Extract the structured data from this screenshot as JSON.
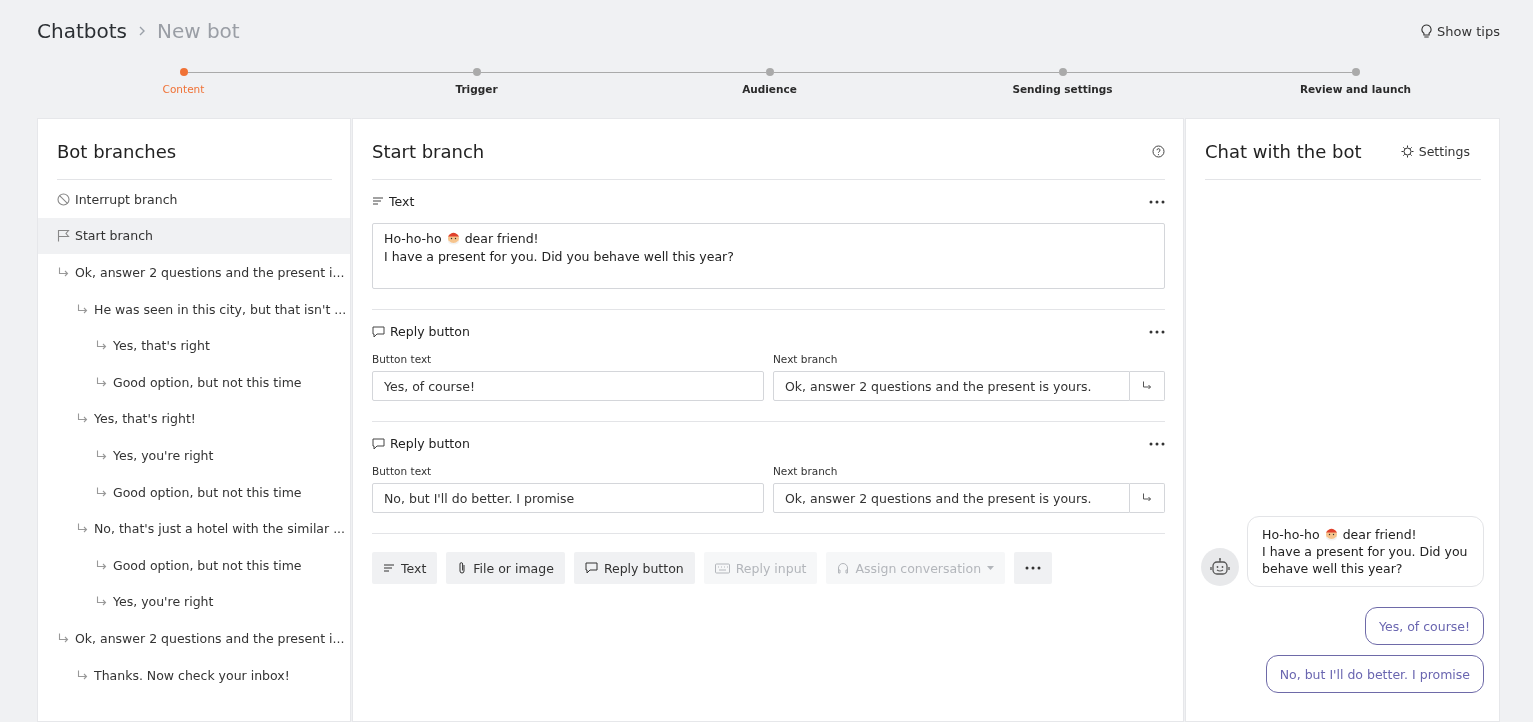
{
  "breadcrumb": {
    "parent": "Chatbots",
    "current": "New bot"
  },
  "tips": {
    "label": "Show tips"
  },
  "steps": [
    {
      "label": "Content",
      "selected": true
    },
    {
      "label": "Trigger",
      "selected": false
    },
    {
      "label": "Audience",
      "selected": false
    },
    {
      "label": "Sending settings",
      "selected": false
    },
    {
      "label": "Review and launch",
      "selected": false
    }
  ],
  "branches": {
    "title": "Bot branches",
    "items": [
      {
        "kind": "interrupt",
        "label": "Interrupt branch",
        "selected": false
      },
      {
        "kind": "start",
        "label": "Start branch",
        "selected": true
      },
      {
        "kind": "branch",
        "label": "Ok, answer 2 questions and the present i...",
        "selected": false,
        "children": [
          {
            "kind": "branch",
            "label": "He was seen in this city, but that isn't ...",
            "selected": false,
            "children": [
              {
                "kind": "branch",
                "label": "Yes, that's right",
                "selected": false
              },
              {
                "kind": "branch",
                "label": "Good option, but not this time",
                "selected": false
              }
            ]
          },
          {
            "kind": "branch",
            "label": "Yes, that's right!",
            "selected": false,
            "children": [
              {
                "kind": "branch",
                "label": "Yes, you're right",
                "selected": false
              },
              {
                "kind": "branch",
                "label": "Good option, but not this time",
                "selected": false
              }
            ]
          },
          {
            "kind": "branch",
            "label": "No, that's just a hotel with the similar ...",
            "selected": false,
            "children": [
              {
                "kind": "branch",
                "label": "Good option, but not this time",
                "selected": false
              },
              {
                "kind": "branch",
                "label": "Yes, you're right",
                "selected": false
              }
            ]
          }
        ]
      },
      {
        "kind": "branch",
        "label": "Ok, answer 2 questions and the present i...",
        "selected": false,
        "children": [
          {
            "kind": "branch",
            "label": "Thanks. Now check your inbox!",
            "selected": false
          }
        ]
      }
    ]
  },
  "editor": {
    "title": "Start branch",
    "blocks": [
      {
        "kind": "text",
        "label": "Text",
        "message": {
          "before": "Ho-ho-ho",
          "after": "dear friend!",
          "rest": "I have a present for you. Did you behave well this year?"
        }
      },
      {
        "kind": "reply_button",
        "label": "Reply button",
        "button_label": "Button text",
        "button_value": "Yes, of course!",
        "next_label": "Next branch",
        "next_value": "Ok, answer 2 questions and the present is yours."
      },
      {
        "kind": "reply_button",
        "label": "Reply button",
        "button_label": "Button text",
        "button_value": "No, but I'll do better. I promise",
        "next_label": "Next branch",
        "next_value": "Ok, answer 2 questions and the present is yours."
      }
    ],
    "toolbar": [
      {
        "kind": "text",
        "label": "Text",
        "disabled": false
      },
      {
        "kind": "file",
        "label": "File or image",
        "disabled": false
      },
      {
        "kind": "reply",
        "label": "Reply button",
        "disabled": false
      },
      {
        "kind": "keyboard",
        "label": "Reply input",
        "disabled": true
      },
      {
        "kind": "assign",
        "label": "Assign conversation",
        "disabled": true
      },
      {
        "kind": "more",
        "disabled": false
      }
    ]
  },
  "chat": {
    "title": "Chat with the bot",
    "settings": "Settings",
    "message": {
      "before": "Ho-ho-ho",
      "after": "dear friend!",
      "rest": "I have a present for you. Did you behave well this year?"
    },
    "replies": [
      "Yes, of course!",
      "No, but I'll do better. I promise"
    ]
  }
}
